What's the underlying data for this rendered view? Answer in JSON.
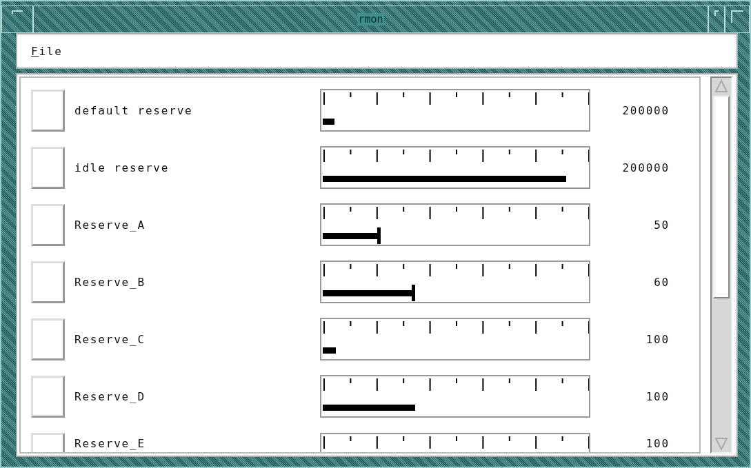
{
  "window": {
    "title": "rmon"
  },
  "menu": [
    {
      "label": "File"
    }
  ],
  "reserves": [
    {
      "name": "default reserve",
      "checked": false,
      "level": 0.045,
      "capped": false,
      "value": "200000"
    },
    {
      "name": "idle reserve",
      "checked": false,
      "level": 0.92,
      "capped": false,
      "value": "200000"
    },
    {
      "name": "Reserve_A",
      "checked": false,
      "level": 0.21,
      "capped": true,
      "value": "50"
    },
    {
      "name": "Reserve_B",
      "checked": false,
      "level": 0.34,
      "capped": true,
      "value": "60"
    },
    {
      "name": "Reserve_C",
      "checked": false,
      "level": 0.05,
      "capped": false,
      "value": "100"
    },
    {
      "name": "Reserve_D",
      "checked": false,
      "level": 0.35,
      "capped": false,
      "value": "100"
    },
    {
      "name": "Reserve_E",
      "checked": false,
      "value": "100"
    }
  ]
}
